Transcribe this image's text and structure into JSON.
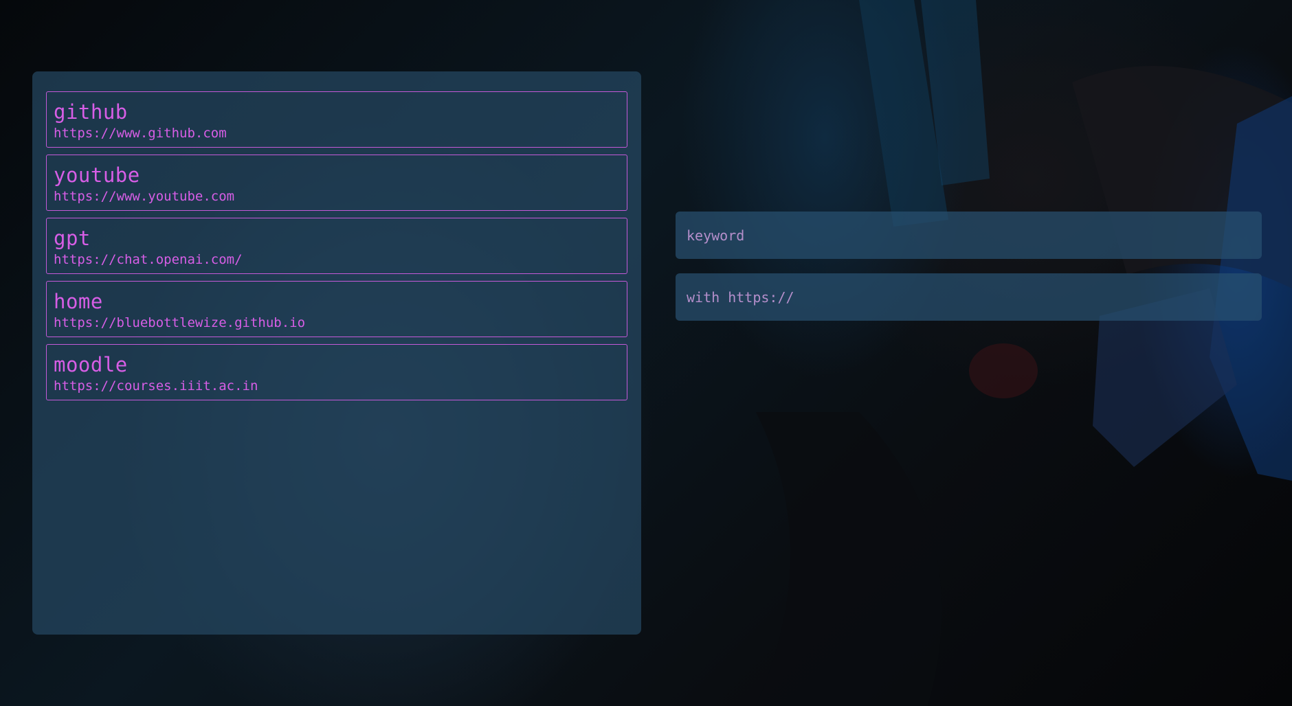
{
  "bookmarks": [
    {
      "name": "github",
      "url": "https://www.github.com"
    },
    {
      "name": "youtube",
      "url": "https://www.youtube.com"
    },
    {
      "name": "gpt",
      "url": "https://chat.openai.com/"
    },
    {
      "name": "home",
      "url": "https://bluebottlewize.github.io"
    },
    {
      "name": "moodle",
      "url": "https://courses.iiit.ac.in"
    }
  ],
  "form": {
    "keyword_placeholder": "keyword",
    "url_placeholder": "with https://"
  },
  "colors": {
    "accent": "#d75ee6",
    "border": "#c55ad9",
    "panel": "#264862",
    "background": "#07090c"
  }
}
